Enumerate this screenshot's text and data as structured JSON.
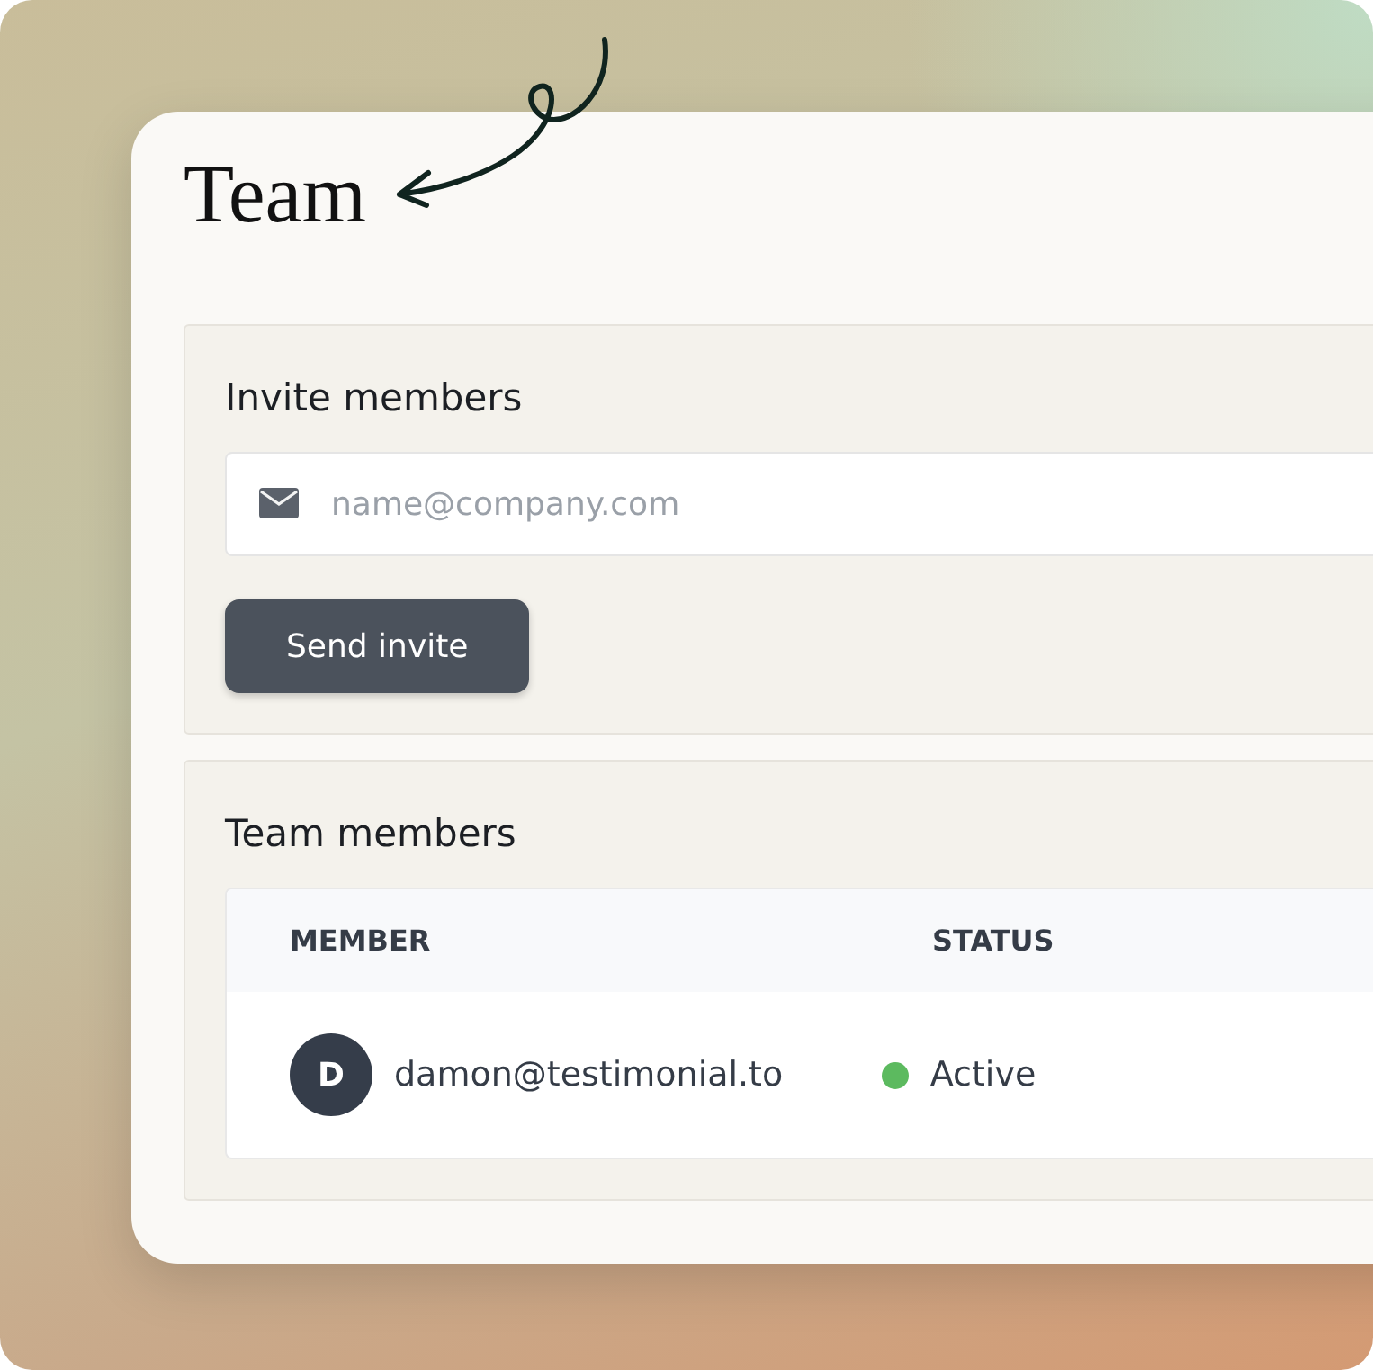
{
  "title": "Team",
  "invite": {
    "heading": "Invite members",
    "email_field": {
      "placeholder": "name@company.com"
    },
    "button": "Send invite"
  },
  "members": {
    "heading": "Team members",
    "columns": [
      "MEMBER",
      "STATUS"
    ],
    "rows": [
      {
        "initial": "D",
        "email": "damon@testimonial.to",
        "status": "Active",
        "color": "#5cba5f"
      }
    ]
  }
}
